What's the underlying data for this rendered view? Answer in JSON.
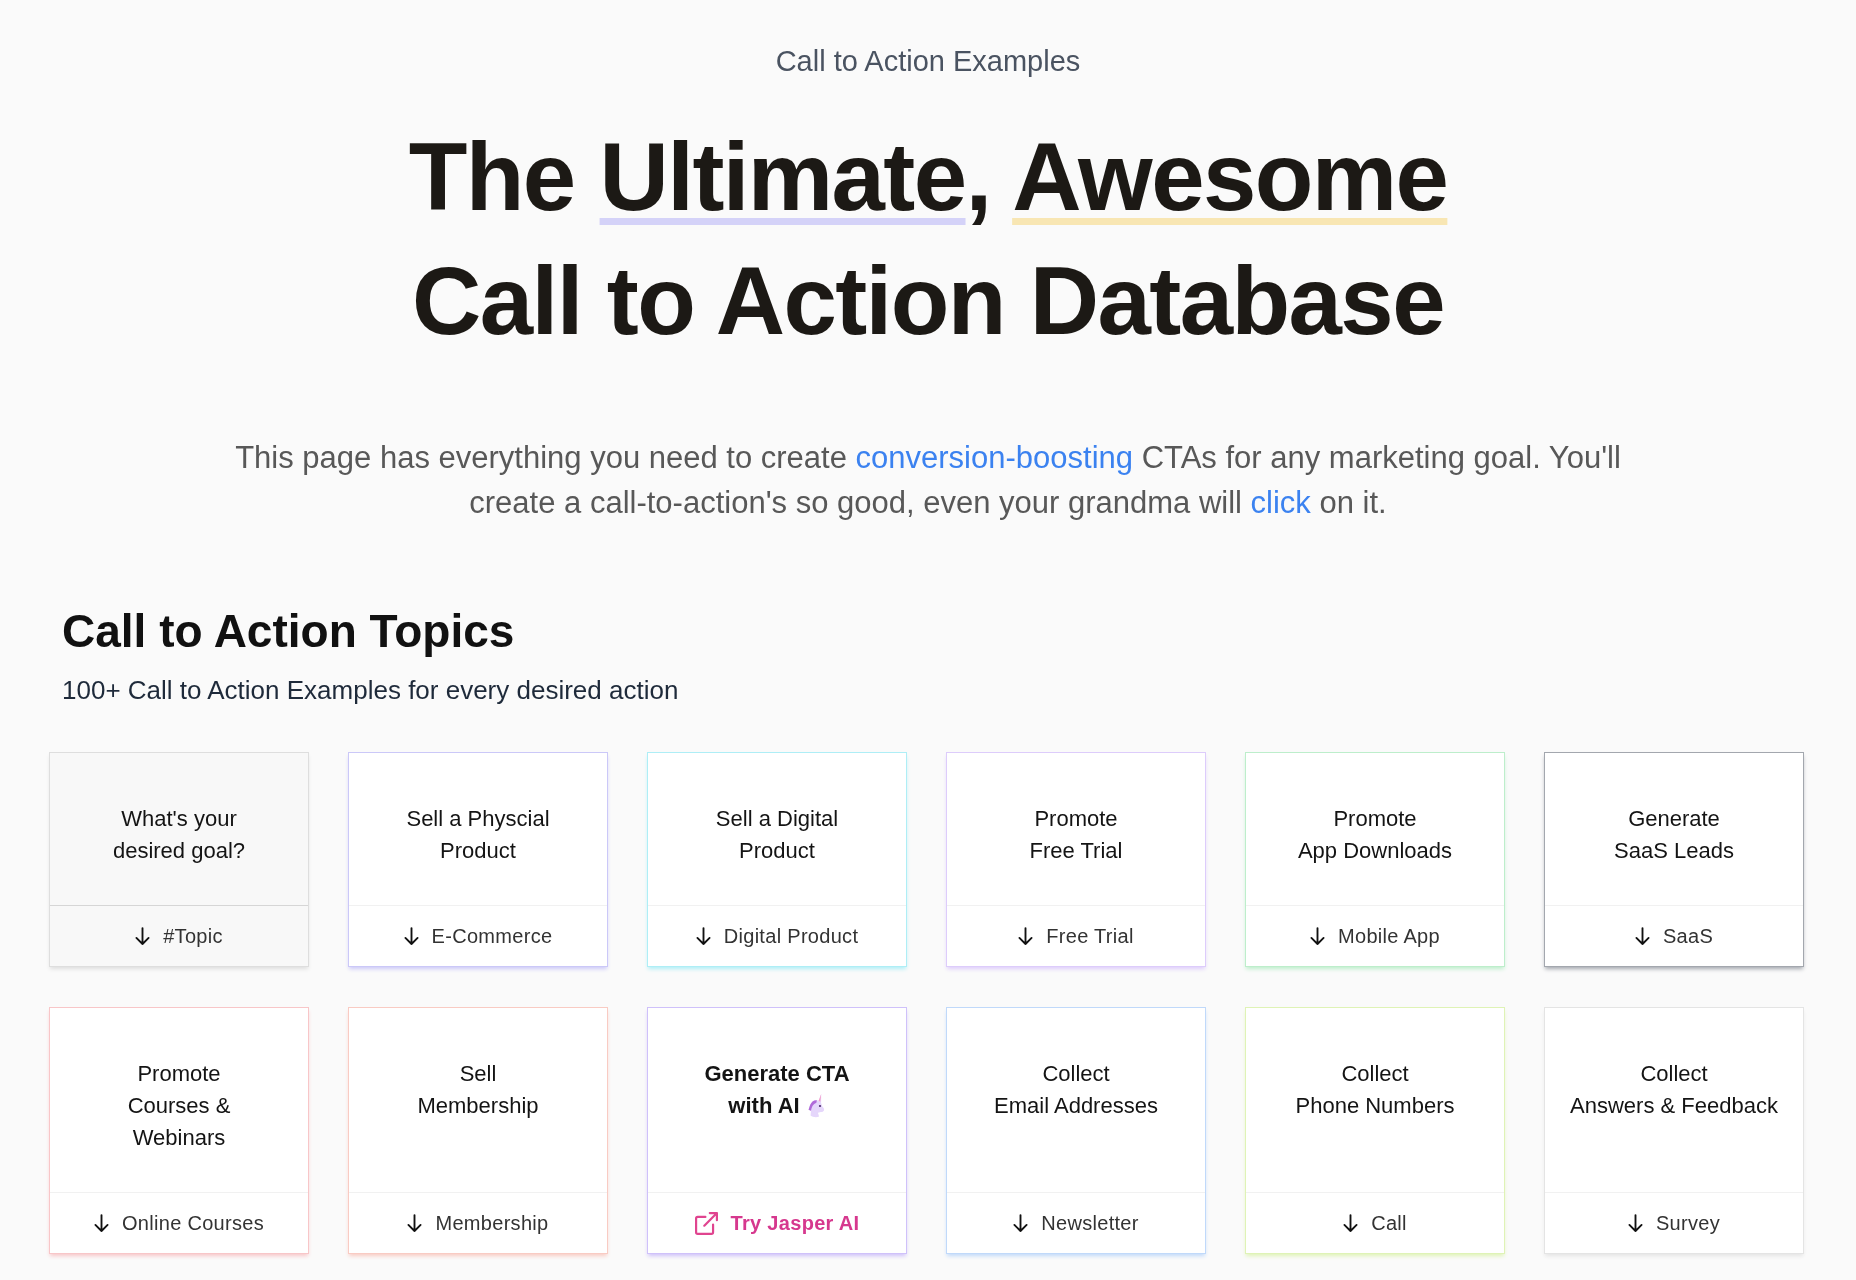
{
  "eyebrow": "Call to Action Examples",
  "title": {
    "lines": [
      [
        {
          "text": "The "
        },
        {
          "text": "Ultimate",
          "color": "#d4d2f8"
        },
        {
          "text": ", "
        },
        {
          "text": "Awesome",
          "color": "#f8e6b3"
        }
      ],
      [
        {
          "text": "Call to Action Database"
        }
      ]
    ]
  },
  "intro": {
    "segments": [
      {
        "text": "This page has everything you need to create "
      },
      {
        "text": "conversion-boosting",
        "kind": "link"
      },
      {
        "text": " CTAs for any marketing goal. You'll create a call-to-action's so good, even your grandma will "
      },
      {
        "text": "click",
        "kind": "link"
      },
      {
        "text": " on it."
      }
    ]
  },
  "topics": {
    "title": "Call to Action Topics",
    "subtitle": "100+ Call to Action Examples for every desired action",
    "cards": [
      {
        "kind": "intro",
        "title": [
          "What's your",
          "desired goal?"
        ],
        "tag": "#Topic",
        "color": "#dedede"
      },
      {
        "kind": "topic",
        "title": [
          "Sell a Physcial",
          "Product"
        ],
        "tag": "E-Commerce",
        "color": "#cbc8f8"
      },
      {
        "kind": "topic",
        "title": [
          "Sell a Digital",
          "Product"
        ],
        "tag": "Digital Product",
        "color": "#aeeef6"
      },
      {
        "kind": "topic",
        "title": [
          "Promote",
          "Free Trial"
        ],
        "tag": "Free Trial",
        "color": "#ddccfb"
      },
      {
        "kind": "topic",
        "title": [
          "Promote",
          "App Downloads"
        ],
        "tag": "Mobile App",
        "color": "#bdeecb"
      },
      {
        "kind": "topic",
        "title": [
          "Generate",
          "SaaS Leads"
        ],
        "tag": "SaaS",
        "color": "#a3a7ae"
      },
      {
        "kind": "topic",
        "title": [
          "Promote",
          "Courses &",
          "Webinars"
        ],
        "tag": "Online Courses",
        "color": "#f8c6c8"
      },
      {
        "kind": "topic",
        "title": [
          "Sell",
          "Membership"
        ],
        "tag": "Membership",
        "color": "#f9cbc3"
      },
      {
        "kind": "external",
        "title": [
          "Generate CTA",
          "with AI"
        ],
        "tag": "Try Jasper AI",
        "color": "#cfc1fa"
      },
      {
        "kind": "topic",
        "title": [
          "Collect",
          "Email Addresses"
        ],
        "tag": "Newsletter",
        "color": "#c0d9fa"
      },
      {
        "kind": "topic",
        "title": [
          "Collect",
          "Phone Numbers"
        ],
        "tag": "Call",
        "color": "#dff3b6"
      },
      {
        "kind": "topic",
        "title": [
          "Collect",
          "Answers & Feedback"
        ],
        "tag": "Survey",
        "color": "#e4e4e4"
      }
    ]
  }
}
